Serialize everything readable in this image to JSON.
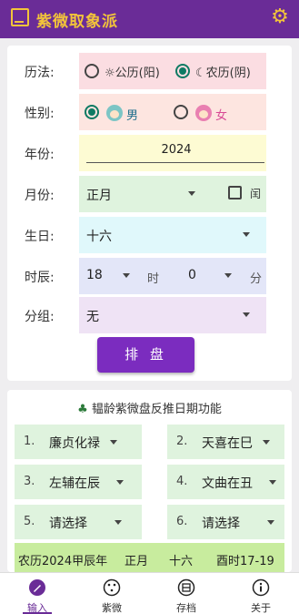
{
  "app": {
    "title": "紫微取象派",
    "accent": "#6a2c97",
    "title_color": "#f2c43a"
  },
  "form": {
    "calendar": {
      "label": "历法:",
      "options": [
        "公历(阳)",
        "农历(阴)"
      ],
      "selected": "农历(阴)",
      "bg": "#fbdde2"
    },
    "gender": {
      "label": "性别:",
      "options": [
        "男",
        "女"
      ],
      "selected": "男",
      "bg": "#fde5e0"
    },
    "year": {
      "label": "年份:",
      "value": "2024",
      "bg": "#fdfbd3"
    },
    "month": {
      "label": "月份:",
      "value": "正月",
      "leap_label": "闰",
      "leap_checked": false,
      "bg": "#dff3de"
    },
    "day": {
      "label": "生日:",
      "value": "十六",
      "bg": "#e0f8fb"
    },
    "time": {
      "label": "时辰:",
      "hour": "18",
      "hour_unit": "时",
      "minute": "0",
      "minute_unit": "分",
      "bg": "#e3e6f8"
    },
    "group": {
      "label": "分组:",
      "value": "无",
      "bg": "#efe3f5"
    },
    "submit_label": "排 盘"
  },
  "reverse": {
    "title": "韫龄紫微盘反推日期功能",
    "items": [
      {
        "num": "1.",
        "value": "廉贞化禄"
      },
      {
        "num": "2.",
        "value": "天喜在巳"
      },
      {
        "num": "3.",
        "value": "左辅在辰"
      },
      {
        "num": "4.",
        "value": "文曲在丑"
      },
      {
        "num": "5.",
        "value": "请选择"
      },
      {
        "num": "6.",
        "value": "请选择"
      }
    ],
    "summary": [
      "农历2024甲辰年",
      "正月",
      "十六",
      "酉时17-19"
    ]
  },
  "nav": [
    {
      "label": "输入",
      "icon": "pen-icon",
      "active": true
    },
    {
      "label": "紫微",
      "icon": "chart-circle-icon",
      "active": false
    },
    {
      "label": "存档",
      "icon": "archive-icon",
      "active": false
    },
    {
      "label": "关于",
      "icon": "info-icon",
      "active": false
    }
  ]
}
